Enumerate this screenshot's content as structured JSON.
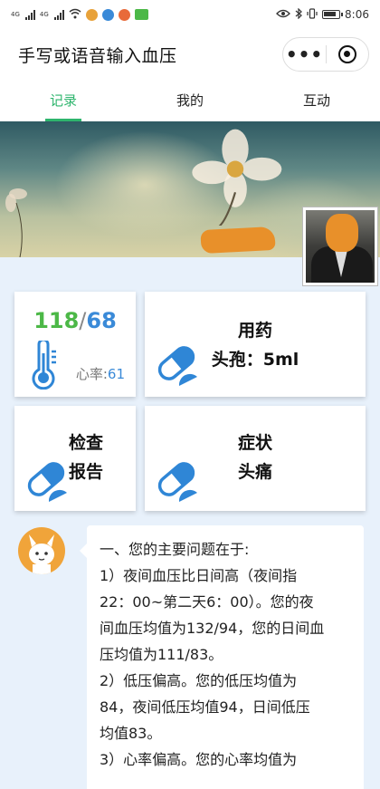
{
  "status_bar": {
    "network_label": "4G",
    "time": "8:06"
  },
  "nav": {
    "title": "手写或语音输入血压",
    "more_label": "•••"
  },
  "tabs": [
    {
      "label": "记录",
      "active": true
    },
    {
      "label": "我的",
      "active": false
    },
    {
      "label": "互动",
      "active": false
    }
  ],
  "colors": {
    "accent_green": "#2eb56d",
    "systolic": "#4cb847",
    "diastolic": "#3a8ad8",
    "icon_blue": "#2f86d6"
  },
  "cards": {
    "bp": {
      "systolic": "118",
      "separator": "/",
      "diastolic": "68",
      "hr_label": "心率:",
      "hr_value": "61",
      "icon": "thermometer-icon"
    },
    "medication": {
      "line1": "用药",
      "line2": "头孢：5ml",
      "icon": "pill-icon"
    },
    "report": {
      "line1": "检查",
      "line2": "报告",
      "icon": "pill-icon"
    },
    "symptom": {
      "line1": "症状",
      "line2": "头痛",
      "icon": "pill-icon"
    }
  },
  "message": {
    "lines": [
      "一、您的主要问题在于:",
      "1）夜间血压比日间高（夜间指",
      "22：00~第二天6：00）。您的夜",
      "间血压均值为132/94，您的日间血",
      "压均值为111/83。",
      "2）低压偏高。您的低压均值为",
      "84，夜间低压均值94，日间低压",
      "均值83。",
      "3）心率偏高。您的心率均值为"
    ]
  }
}
